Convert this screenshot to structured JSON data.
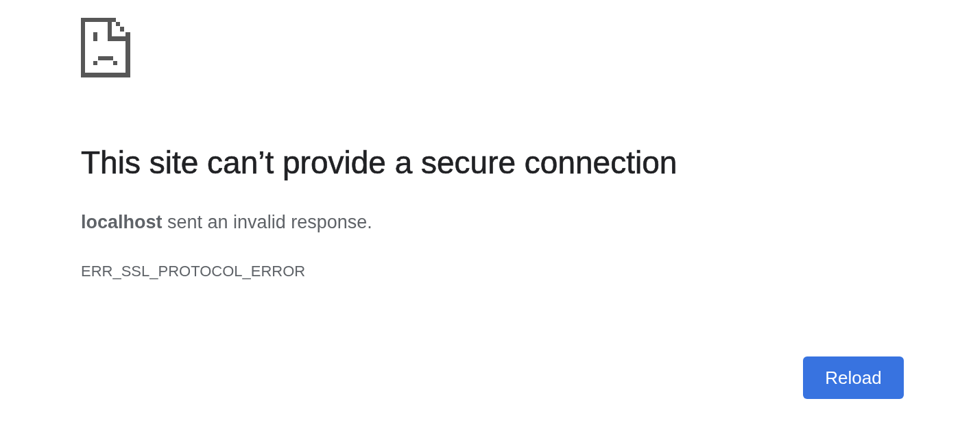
{
  "heading": "This site can’t provide a secure connection",
  "message": "**localhost** sent an invalid response.",
  "error_code": "ERR_SSL_PROTOCOL_ERROR",
  "reload_button": {
    "label": "Reload"
  }
}
